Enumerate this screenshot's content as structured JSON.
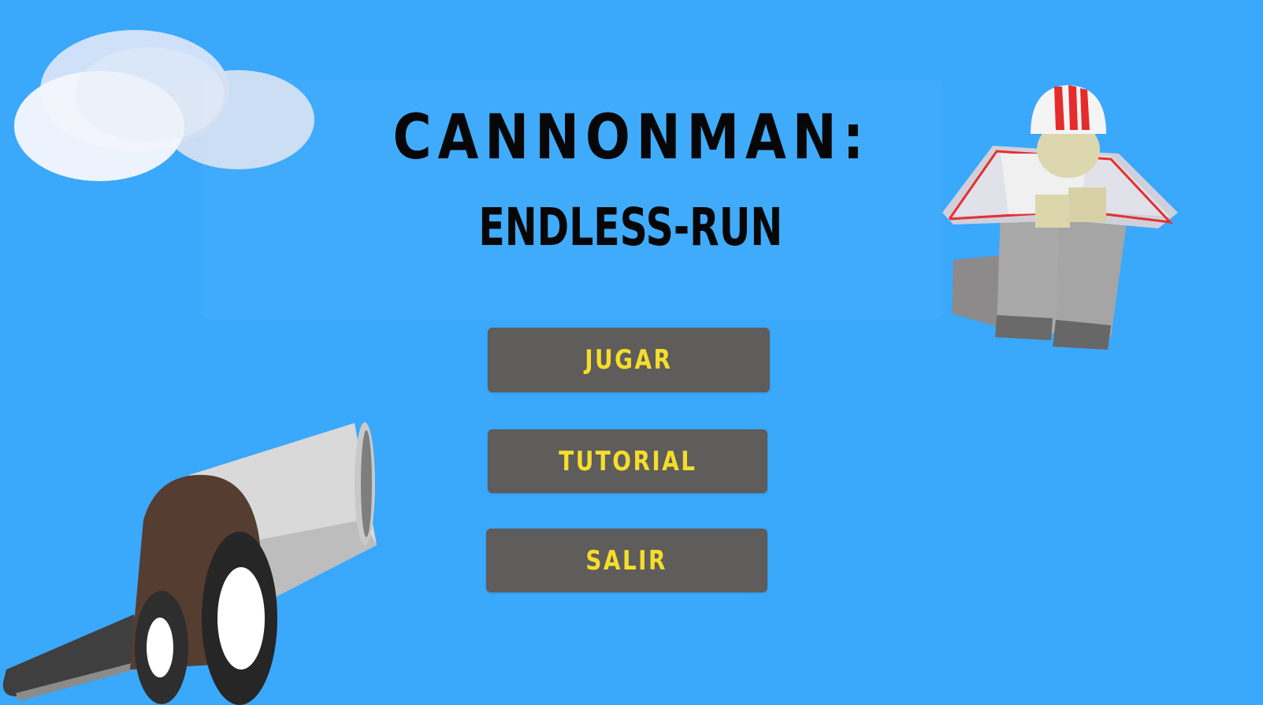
{
  "title": {
    "main": "CANNONMAN:",
    "sub": "ENDLESS-RUN"
  },
  "menu": {
    "play_label": "JUGAR",
    "tutorial_label": "TUTORIAL",
    "exit_label": "SALIR"
  },
  "colors": {
    "sky": "#3aa8fb",
    "button_bg": "#5f5c5c",
    "button_text": "#f5dd2b",
    "title_text": "#070707",
    "cannon_body": "#553d31",
    "cannon_barrel": "#d6d6d6",
    "helmet_stripe": "#e52b2b"
  },
  "decorations": {
    "clouds": "cloud-cluster-illustration",
    "cannon": "cannon-illustration",
    "character": "cannonman-character-illustration"
  }
}
